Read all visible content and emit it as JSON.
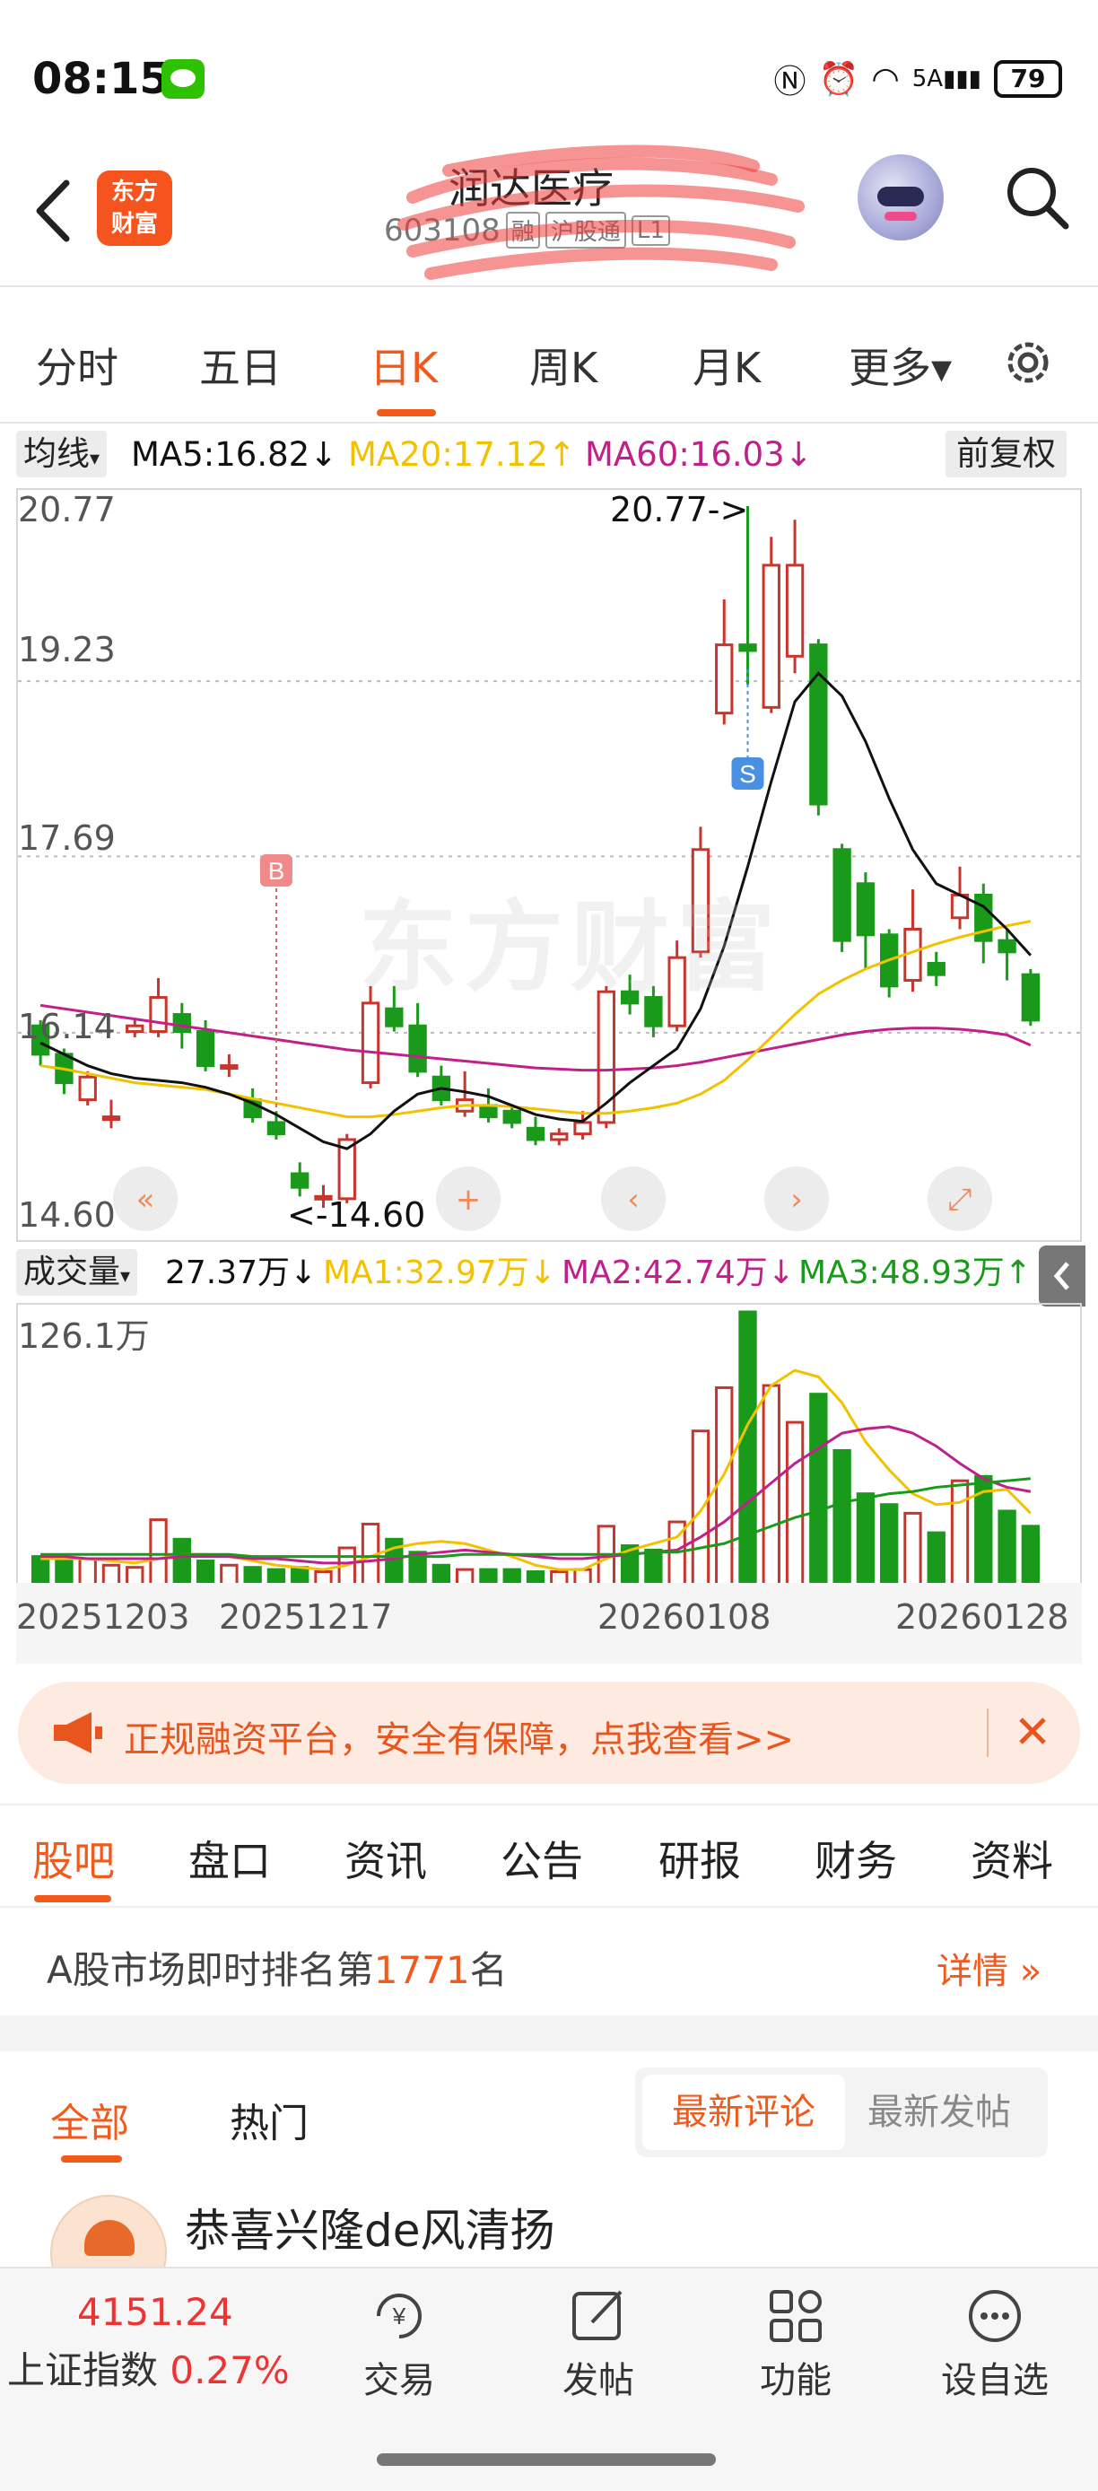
{
  "status": {
    "time": "08:15",
    "battery": "79",
    "network": "5A"
  },
  "header": {
    "stock_name": "润达医疗",
    "stock_code": "603108",
    "tags": [
      "融",
      "沪股通",
      "L1"
    ],
    "logo_line1": "东方",
    "logo_line2": "财富"
  },
  "period_tabs": [
    "分时",
    "五日",
    "日K",
    "周K",
    "月K",
    "更多▾"
  ],
  "active_period": "日K",
  "ma": {
    "selector": "均线",
    "ma5": "MA5:16.82↓",
    "ma20": "MA20:17.12↑",
    "ma60": "MA60:16.03↓",
    "adjust": "前复权",
    "colors": {
      "ma5": "#111111",
      "ma20": "#f2c200",
      "ma60": "#c0208a"
    }
  },
  "chart": {
    "y_labels": [
      "20.77",
      "19.23",
      "17.69",
      "16.14",
      "14.60"
    ],
    "high_marker": "20.77->",
    "low_marker": "<-14.60",
    "buy_badge": "B",
    "sell_badge": "S",
    "watermark": "东方财富",
    "up_color": "#c8352c",
    "down_color": "#1a9a1a"
  },
  "volume": {
    "selector": "成交量",
    "current": "27.37万↓",
    "ma1": "MA1:32.97万↓",
    "ma2": "MA2:42.74万↓",
    "ma3": "MA3:48.93万↑",
    "max_label": "126.1万"
  },
  "dates": [
    "20251203",
    "20251217",
    "20260108",
    "20260128"
  ],
  "chart_data": {
    "type": "candlestick",
    "ylim": [
      14.6,
      20.77
    ],
    "candles": [
      {
        "o": 16.2,
        "c": 15.95,
        "h": 16.25,
        "l": 15.85,
        "v": 13
      },
      {
        "o": 15.95,
        "c": 15.7,
        "h": 16.0,
        "l": 15.6,
        "v": 11
      },
      {
        "o": 15.55,
        "c": 15.75,
        "h": 15.8,
        "l": 15.5,
        "v": 12
      },
      {
        "o": 15.4,
        "c": 15.4,
        "h": 15.55,
        "l": 15.3,
        "v": 9
      },
      {
        "o": 16.15,
        "c": 16.2,
        "h": 16.25,
        "l": 16.1,
        "v": 8
      },
      {
        "o": 16.15,
        "c": 16.45,
        "h": 16.62,
        "l": 16.1,
        "v": 30
      },
      {
        "o": 16.3,
        "c": 16.15,
        "h": 16.4,
        "l": 16.0,
        "v": 21
      },
      {
        "o": 16.15,
        "c": 15.85,
        "h": 16.25,
        "l": 15.8,
        "v": 11
      },
      {
        "o": 15.85,
        "c": 15.85,
        "h": 15.95,
        "l": 15.75,
        "v": 9
      },
      {
        "o": 15.55,
        "c": 15.4,
        "h": 15.65,
        "l": 15.35,
        "v": 8
      },
      {
        "o": 15.35,
        "c": 15.25,
        "h": 15.45,
        "l": 15.2,
        "v": 7
      },
      {
        "o": 14.9,
        "c": 14.78,
        "h": 15.0,
        "l": 14.7,
        "v": 8
      },
      {
        "o": 14.7,
        "c": 14.7,
        "h": 14.8,
        "l": 14.6,
        "v": 6
      },
      {
        "o": 14.68,
        "c": 15.2,
        "h": 15.25,
        "l": 14.64,
        "v": 17
      },
      {
        "o": 15.7,
        "c": 16.4,
        "h": 16.55,
        "l": 15.65,
        "v": 28
      },
      {
        "o": 16.35,
        "c": 16.2,
        "h": 16.55,
        "l": 16.15,
        "v": 21
      },
      {
        "o": 16.2,
        "c": 15.8,
        "h": 16.4,
        "l": 15.75,
        "v": 15
      },
      {
        "o": 15.75,
        "c": 15.55,
        "h": 15.85,
        "l": 15.5,
        "v": 9
      },
      {
        "o": 15.45,
        "c": 15.55,
        "h": 15.8,
        "l": 15.4,
        "v": 7
      },
      {
        "o": 15.5,
        "c": 15.4,
        "h": 15.65,
        "l": 15.35,
        "v": 7
      },
      {
        "o": 15.45,
        "c": 15.35,
        "h": 15.5,
        "l": 15.3,
        "v": 7
      },
      {
        "o": 15.3,
        "c": 15.2,
        "h": 15.4,
        "l": 15.15,
        "v": 6
      },
      {
        "o": 15.2,
        "c": 15.25,
        "h": 15.3,
        "l": 15.15,
        "v": 6
      },
      {
        "o": 15.25,
        "c": 15.35,
        "h": 15.45,
        "l": 15.2,
        "v": 7
      },
      {
        "o": 15.35,
        "c": 16.5,
        "h": 16.55,
        "l": 15.3,
        "v": 27
      },
      {
        "o": 16.5,
        "c": 16.4,
        "h": 16.65,
        "l": 16.3,
        "v": 18
      },
      {
        "o": 16.45,
        "c": 16.2,
        "h": 16.55,
        "l": 16.1,
        "v": 16
      },
      {
        "o": 16.2,
        "c": 16.8,
        "h": 16.95,
        "l": 16.15,
        "v": 29
      },
      {
        "o": 16.85,
        "c": 17.75,
        "h": 17.95,
        "l": 16.8,
        "v": 71
      },
      {
        "o": 18.95,
        "c": 19.55,
        "h": 19.95,
        "l": 18.85,
        "v": 91
      },
      {
        "o": 19.55,
        "c": 19.5,
        "h": 20.77,
        "l": 19.2,
        "v": 126
      },
      {
        "o": 19.0,
        "c": 20.25,
        "h": 20.5,
        "l": 18.95,
        "v": 92
      },
      {
        "o": 19.45,
        "c": 20.25,
        "h": 20.65,
        "l": 19.3,
        "v": 75
      },
      {
        "o": 19.55,
        "c": 18.15,
        "h": 19.6,
        "l": 18.05,
        "v": 88
      },
      {
        "o": 17.75,
        "c": 16.95,
        "h": 17.8,
        "l": 16.85,
        "v": 62
      },
      {
        "o": 17.45,
        "c": 17.0,
        "h": 17.55,
        "l": 16.7,
        "v": 42
      },
      {
        "o": 17.0,
        "c": 16.55,
        "h": 17.05,
        "l": 16.45,
        "v": 37
      },
      {
        "o": 16.6,
        "c": 17.05,
        "h": 17.4,
        "l": 16.5,
        "v": 33
      },
      {
        "o": 16.75,
        "c": 16.65,
        "h": 16.85,
        "l": 16.55,
        "v": 24
      },
      {
        "o": 17.15,
        "c": 17.35,
        "h": 17.6,
        "l": 17.05,
        "v": 48
      },
      {
        "o": 17.35,
        "c": 16.95,
        "h": 17.45,
        "l": 16.75,
        "v": 50
      },
      {
        "o": 16.95,
        "c": 16.85,
        "h": 17.05,
        "l": 16.6,
        "v": 34
      },
      {
        "o": 16.65,
        "c": 16.25,
        "h": 16.7,
        "l": 16.2,
        "v": 27
      }
    ],
    "ma5": [
      16.05,
      15.95,
      15.85,
      15.78,
      15.74,
      15.72,
      15.7,
      15.66,
      15.6,
      15.52,
      15.42,
      15.3,
      15.18,
      15.12,
      15.25,
      15.45,
      15.6,
      15.65,
      15.62,
      15.58,
      15.5,
      15.42,
      15.38,
      15.36,
      15.52,
      15.7,
      15.85,
      16.0,
      16.35,
      16.9,
      17.6,
      18.35,
      19.05,
      19.3,
      19.1,
      18.7,
      18.2,
      17.75,
      17.45,
      17.35,
      17.25,
      17.05,
      16.82
    ],
    "ma20": [
      15.85,
      15.82,
      15.78,
      15.74,
      15.7,
      15.68,
      15.66,
      15.64,
      15.6,
      15.56,
      15.52,
      15.48,
      15.44,
      15.4,
      15.4,
      15.42,
      15.45,
      15.48,
      15.5,
      15.5,
      15.49,
      15.47,
      15.45,
      15.43,
      15.43,
      15.45,
      15.48,
      15.52,
      15.6,
      15.72,
      15.9,
      16.1,
      16.3,
      16.48,
      16.6,
      16.7,
      16.78,
      16.85,
      16.92,
      16.98,
      17.03,
      17.08,
      17.12
    ],
    "ma60": [
      16.38,
      16.35,
      16.32,
      16.29,
      16.26,
      16.23,
      16.2,
      16.17,
      16.14,
      16.11,
      16.08,
      16.05,
      16.02,
      15.99,
      15.97,
      15.95,
      15.93,
      15.91,
      15.89,
      15.87,
      15.85,
      15.83,
      15.82,
      15.81,
      15.81,
      15.82,
      15.83,
      15.85,
      15.88,
      15.92,
      15.96,
      16.0,
      16.04,
      16.08,
      16.12,
      16.15,
      16.17,
      16.18,
      16.18,
      16.17,
      16.15,
      16.12,
      16.03
    ],
    "vol_ma1": [
      12,
      12,
      12,
      11,
      10,
      12,
      14,
      14,
      13,
      11,
      9,
      8,
      7,
      9,
      13,
      17,
      19,
      20,
      19,
      16,
      13,
      9,
      7,
      7,
      12,
      16,
      19,
      22,
      34,
      51,
      74,
      92,
      99,
      96,
      84,
      66,
      53,
      42,
      37,
      38,
      43,
      44,
      33
    ],
    "vol_ma2": [
      13,
      13,
      12,
      12,
      12,
      12,
      13,
      13,
      13,
      12,
      12,
      11,
      10,
      10,
      11,
      12,
      14,
      15,
      16,
      15,
      14,
      13,
      12,
      12,
      13,
      14,
      15,
      16,
      22,
      29,
      38,
      47,
      56,
      63,
      70,
      72,
      73,
      70,
      64,
      56,
      49,
      45,
      43
    ],
    "vol_ma3": [
      14,
      14,
      14,
      14,
      14,
      14,
      14,
      14,
      14,
      13,
      13,
      13,
      13,
      13,
      13,
      13,
      13,
      13,
      14,
      14,
      14,
      14,
      14,
      14,
      14,
      14,
      15,
      15,
      17,
      19,
      23,
      27,
      31,
      34,
      38,
      40,
      42,
      43,
      45,
      46,
      47,
      48,
      49
    ]
  },
  "ad": {
    "text": "正规融资平台，安全有保障，点我查看>>"
  },
  "info_tabs": [
    "股吧",
    "盘口",
    "资讯",
    "公告",
    "研报",
    "财务",
    "资料"
  ],
  "rank": {
    "prefix": "A股市场即时排名第",
    "number": "1771",
    "suffix": "名",
    "detail": "详情"
  },
  "feed_tabs": [
    "全部",
    "热门"
  ],
  "sort": [
    "最新评论",
    "最新发帖"
  ],
  "post": {
    "user": "恭喜兴隆de风清扬"
  },
  "bottom": {
    "index_value": "4151.24",
    "index_name": "上证指数",
    "index_change": "0.27%",
    "nav": [
      "交易",
      "发帖",
      "功能",
      "设自选"
    ]
  }
}
